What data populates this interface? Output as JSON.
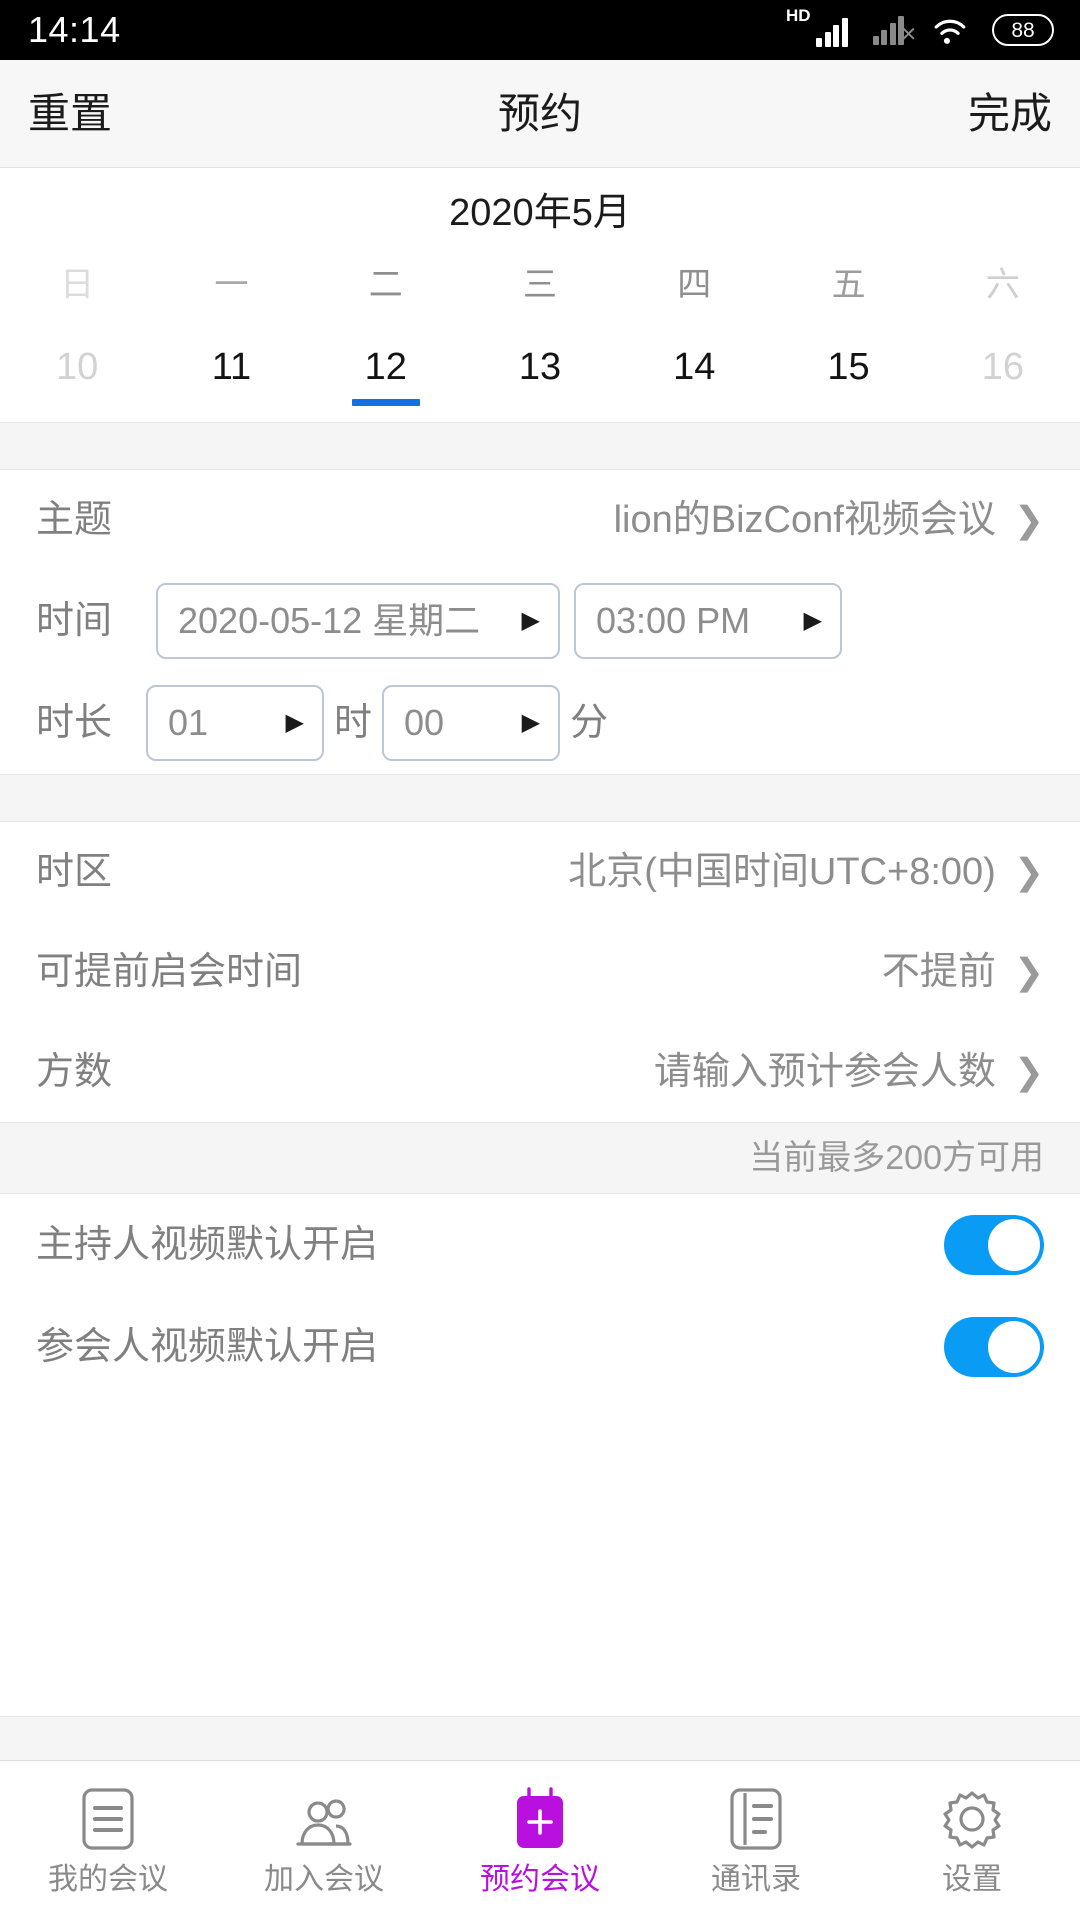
{
  "status_bar": {
    "time": "14:14",
    "hd_label": "HD",
    "battery_level": "88",
    "icons": [
      "hd-signal-icon",
      "signal-bars-icon",
      "signal-bars-no-service-icon",
      "wifi-icon",
      "battery-icon"
    ]
  },
  "navbar": {
    "reset_label": "重置",
    "title": "预约",
    "done_label": "完成"
  },
  "calendar": {
    "month_label": "2020年5月",
    "weekdays": [
      {
        "label": "日",
        "muted": true
      },
      {
        "label": "一",
        "muted": false
      },
      {
        "label": "二",
        "muted": false
      },
      {
        "label": "三",
        "muted": false
      },
      {
        "label": "四",
        "muted": false
      },
      {
        "label": "五",
        "muted": false
      },
      {
        "label": "六",
        "muted": true
      }
    ],
    "days": [
      {
        "num": "10",
        "disabled": true,
        "selected": false
      },
      {
        "num": "11",
        "disabled": false,
        "selected": false
      },
      {
        "num": "12",
        "disabled": false,
        "selected": true
      },
      {
        "num": "13",
        "disabled": false,
        "selected": false
      },
      {
        "num": "14",
        "disabled": false,
        "selected": false
      },
      {
        "num": "15",
        "disabled": false,
        "selected": false
      },
      {
        "num": "16",
        "disabled": true,
        "selected": false
      }
    ],
    "selected_indicator_color": "#1271dd"
  },
  "form": {
    "topic": {
      "label": "主题",
      "value": "lion的BizConf视频会议"
    },
    "time": {
      "label": "时间",
      "date_value": "2020-05-12 星期二",
      "clock_value": "03:00 PM"
    },
    "duration": {
      "label": "时长",
      "hours_value": "01",
      "hours_unit": "时",
      "minutes_value": "00",
      "minutes_unit": "分"
    },
    "timezone": {
      "label": "时区",
      "value": "北京(中国时间UTC+8:00)"
    },
    "early_start": {
      "label": "可提前启会时间",
      "value": "不提前"
    },
    "party_count": {
      "label": "方数",
      "value": "请输入预计参会人数"
    },
    "capacity_note": "当前最多200方可用",
    "host_video": {
      "label": "主持人视频默认开启",
      "enabled": true
    },
    "attendee_video": {
      "label": "参会人视频默认开启",
      "enabled": true
    },
    "switch_on_color": "#0a9cf5"
  },
  "tabbar": {
    "active_color": "#b910e0",
    "items": [
      {
        "label": "我的会议",
        "icon": "list-document-icon",
        "active": false
      },
      {
        "label": "加入会议",
        "icon": "people-group-icon",
        "active": false
      },
      {
        "label": "预约会议",
        "icon": "calendar-plus-icon",
        "active": true
      },
      {
        "label": "通讯录",
        "icon": "contacts-book-icon",
        "active": false
      },
      {
        "label": "设置",
        "icon": "gear-icon",
        "active": false
      }
    ]
  }
}
